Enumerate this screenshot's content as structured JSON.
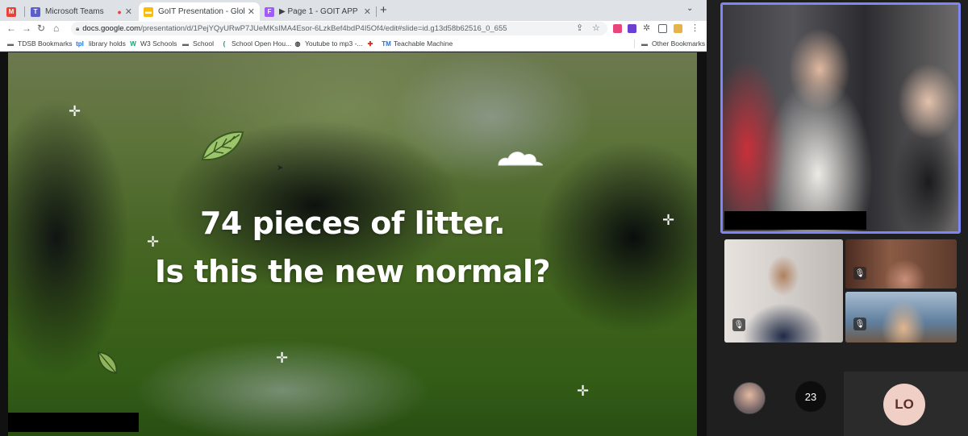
{
  "browser": {
    "tabs": [
      {
        "title": "",
        "favicon": "M",
        "color": "#ea4335"
      },
      {
        "title": "Microsoft Teams",
        "favicon": "T",
        "color": "#5b5fc7"
      },
      {
        "title": "GoIT Presentation - Global - G",
        "favicon": "▬",
        "color": "#fbbc04"
      },
      {
        "title": "▶ Page 1 - GOIT APP",
        "favicon": "F",
        "color": "#a259ff"
      }
    ],
    "url_domain": "docs.google.com",
    "url_path": "/presentation/d/1PejYQyURwP7JUeMKsIMA4Esor-6LzkBef4bdP4I5Of4/edit#slide=id.g13d58b62516_0_655",
    "bookmarks": [
      {
        "label": "TDSB Bookmarks",
        "icon": "folder-icon"
      },
      {
        "label": "library holds",
        "icon": "tpl-icon"
      },
      {
        "label": "W3 Schools",
        "icon": "w3-icon"
      },
      {
        "label": "School",
        "icon": "folder-icon"
      },
      {
        "label": "School Open Hou...",
        "icon": "school-icon"
      },
      {
        "label": "Youtube to mp3 -...",
        "icon": "globe-icon"
      },
      {
        "label": "",
        "icon": "flag-icon"
      },
      {
        "label": "Teachable Machine",
        "icon": "tm-icon"
      }
    ],
    "other_bookmarks": "Other Bookmarks"
  },
  "slide": {
    "line1": "74 pieces of litter.",
    "line2": "Is this the new normal?"
  },
  "teams": {
    "participant_count": "23",
    "initials": "LO",
    "accent_color": "#7f85f5"
  }
}
